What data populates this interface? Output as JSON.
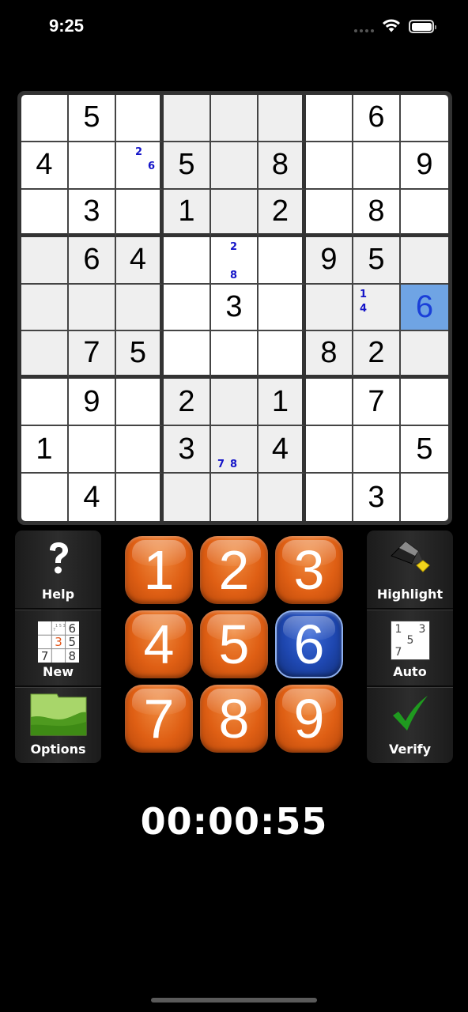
{
  "status_bar": {
    "time": "9:25",
    "wifi_icon": "wifi-icon",
    "battery_icon": "battery-icon"
  },
  "board": {
    "rows": [
      [
        "",
        "5",
        "",
        "",
        "",
        "",
        "",
        "6",
        ""
      ],
      [
        "4",
        "",
        "",
        "5",
        "",
        "8",
        "",
        "",
        "9"
      ],
      [
        "",
        "3",
        "",
        "1",
        "",
        "2",
        "",
        "8",
        ""
      ],
      [
        "",
        "6",
        "4",
        "",
        "",
        "",
        "9",
        "5",
        ""
      ],
      [
        "",
        "",
        "",
        "",
        "3",
        "",
        "",
        "",
        "6"
      ],
      [
        "",
        "7",
        "5",
        "",
        "",
        "",
        "8",
        "2",
        ""
      ],
      [
        "",
        "9",
        "",
        "2",
        "",
        "1",
        "",
        "7",
        ""
      ],
      [
        "1",
        "",
        "",
        "3",
        "",
        "4",
        "",
        "",
        "5"
      ],
      [
        "",
        "4",
        "",
        "",
        "",
        "",
        "",
        "3",
        ""
      ]
    ],
    "pencil_marks": [
      {
        "row": 1,
        "col": 2,
        "marks": [
          "2",
          "6"
        ]
      },
      {
        "row": 3,
        "col": 4,
        "marks": [
          "2",
          "8"
        ]
      },
      {
        "row": 4,
        "col": 7,
        "marks": [
          "1",
          "4"
        ]
      },
      {
        "row": 7,
        "col": 4,
        "marks": [
          "7",
          "8"
        ]
      }
    ],
    "selected_cell": {
      "row": 4,
      "col": 8,
      "value": "6"
    },
    "colors": {
      "selected_bg": "#6fa4e4",
      "selected_text": "#1a3fd8",
      "pencil": "#1414c8",
      "shaded_box": "#efefef"
    }
  },
  "left_panel": {
    "help": {
      "label": "Help",
      "icon": "question-mark-icon"
    },
    "new": {
      "label": "New",
      "icon": "mini-sudoku-icon",
      "icon_digits": [
        "6",
        "3",
        "5",
        "7",
        "8"
      ]
    },
    "options": {
      "label": "Options",
      "icon": "folder-icon"
    }
  },
  "right_panel": {
    "highlight": {
      "label": "Highlight",
      "icon": "highlighter-icon"
    },
    "auto": {
      "label": "Auto",
      "icon": "pencil-marks-icon",
      "icon_digits": [
        "1",
        "3",
        "5",
        "7"
      ]
    },
    "verify": {
      "label": "Verify",
      "icon": "checkmark-icon"
    }
  },
  "keypad": {
    "keys": [
      "1",
      "2",
      "3",
      "4",
      "5",
      "6",
      "7",
      "8",
      "9"
    ],
    "active_key": "6",
    "colors": {
      "key": "#df5f14",
      "active": "#1e47b0"
    }
  },
  "timer": "00:00:55"
}
